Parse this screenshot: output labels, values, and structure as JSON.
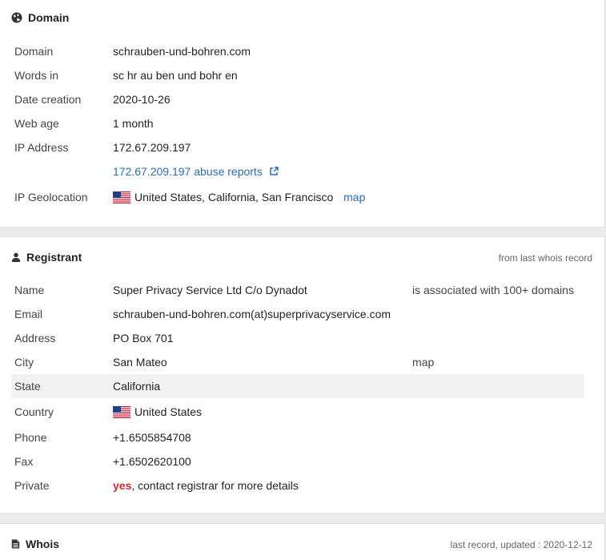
{
  "colors": {
    "link": "#2a6db5",
    "private_yes": "#d12c2c",
    "shaded_row": "#f2f2f2"
  },
  "domain_panel": {
    "title": "Domain",
    "icon": "globe-icon",
    "rows": {
      "domain": {
        "label": "Domain",
        "value": "schrauben-und-bohren.com"
      },
      "words": {
        "label": "Words in",
        "value": "sc hr au ben und bohr en"
      },
      "date_creation": {
        "label": "Date creation",
        "value": "2020-10-26"
      },
      "web_age": {
        "label": "Web age",
        "value": "1 month"
      },
      "ip": {
        "label": "IP Address",
        "value": "172.67.209.197",
        "abuse_link": "172.67.209.197 abuse reports"
      },
      "geo": {
        "label": "IP Geolocation",
        "flag": "us-flag-icon",
        "value": "United States, California, San Francisco",
        "map_link": "map"
      }
    }
  },
  "registrant_panel": {
    "title": "Registrant",
    "icon": "user-icon",
    "note": "from last whois record",
    "rows": {
      "name": {
        "label": "Name",
        "value": "Super Privacy Service Ltd C/o Dynadot",
        "extra": "is associated with 100+ domains"
      },
      "email": {
        "label": "Email",
        "value": "schrauben-und-bohren.com(at)superprivacyservice.com"
      },
      "address": {
        "label": "Address",
        "value": "PO Box 701"
      },
      "city": {
        "label": "City",
        "value": "San Mateo",
        "map_link": "map"
      },
      "state": {
        "label": "State",
        "value": "California"
      },
      "country": {
        "label": "Country",
        "flag": "us-flag-icon",
        "value": "United States"
      },
      "phone": {
        "label": "Phone",
        "value": "+1.6505854708"
      },
      "fax": {
        "label": "Fax",
        "value": "+1.6502620100"
      },
      "private": {
        "label": "Private",
        "value_flag": "yes",
        "value_rest": ", contact registrar for more details"
      }
    }
  },
  "whois_panel": {
    "title": "Whois",
    "icon": "document-icon",
    "note": "last record, updated : 2020-12-12"
  }
}
